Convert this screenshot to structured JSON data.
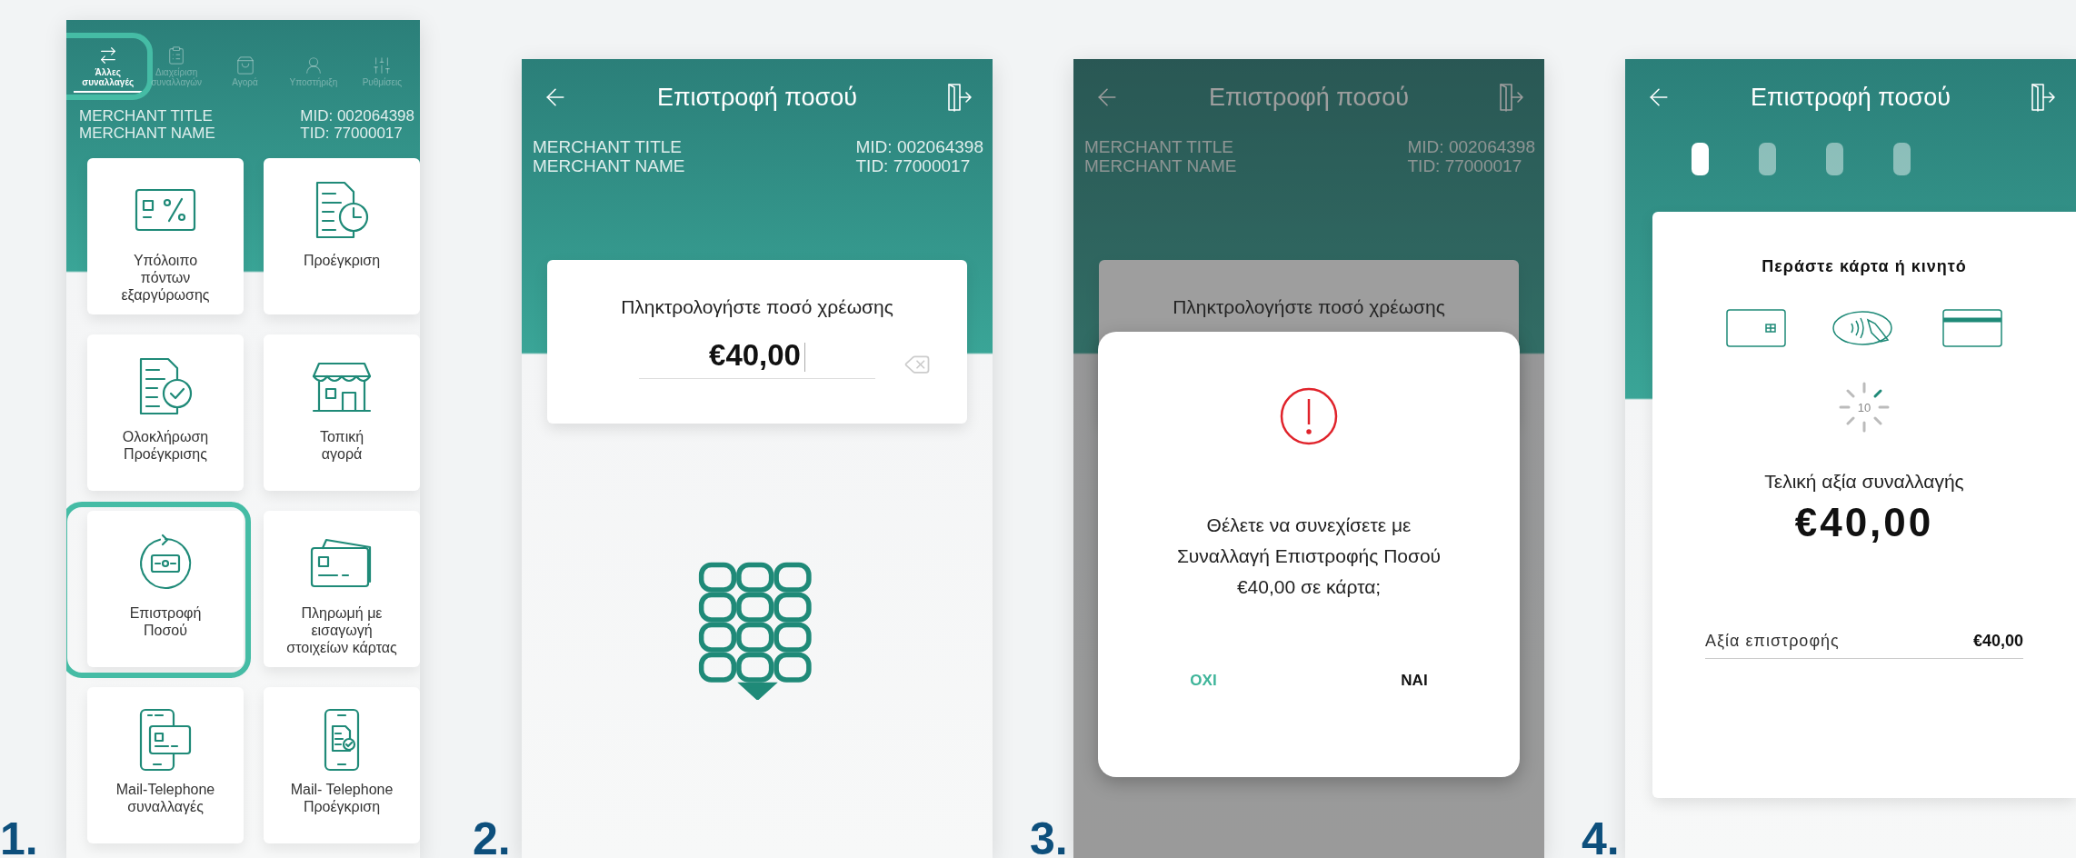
{
  "steps": [
    {
      "number": "1.",
      "kind": "menu",
      "screen": {
        "tabs": [
          {
            "label": "Άλλες\nσυναλλαγές",
            "selected": true,
            "highlighted": true
          },
          {
            "label": "Διαχείριση\nσυναλλαγών",
            "selected": false,
            "highlighted": false
          },
          {
            "label": "Αγορά",
            "selected": false,
            "highlighted": false
          },
          {
            "label": "Υποστήριξη",
            "selected": false,
            "highlighted": false
          },
          {
            "label": "Ρυθμίσεις",
            "selected": false,
            "highlighted": false
          }
        ],
        "merchant": {
          "title": "MERCHANT TITLE",
          "name": "MERCHANT NAME",
          "mid": "MID: 002064398",
          "tid": "TID: 77000017"
        },
        "tiles": [
          {
            "label": "Υπόλοιπο\nπόντων\nεξαργύρωσης",
            "highlighted": false
          },
          {
            "label": "Προέγκριση",
            "highlighted": false
          },
          {
            "label": "Ολοκλήρωση\nΠροέγκρισης",
            "highlighted": false
          },
          {
            "label": "Τοπική\nαγορά",
            "highlighted": false
          },
          {
            "label": "Επιστροφή\nΠοσού",
            "highlighted": true
          },
          {
            "label": "Πληρωμή με\nεισαγωγή\nστοιχείων κάρτας",
            "highlighted": false
          },
          {
            "label": "Mail-Telephone\nσυναλλαγές",
            "highlighted": false
          },
          {
            "label": "Mail- Telephone\nΠροέγκριση",
            "highlighted": false
          }
        ]
      }
    },
    {
      "number": "2.",
      "kind": "amount-entry",
      "screen": {
        "title": "Επιστροφή ποσού",
        "merchant": {
          "title": "MERCHANT TITLE",
          "name": "MERCHANT NAME",
          "mid": "MID: 002064398",
          "tid": "TID: 77000017"
        },
        "amount_label": "Πληκτρολογήστε ποσό χρέωσης",
        "amount_value": "€40,00"
      }
    },
    {
      "number": "3.",
      "kind": "confirm-dialog",
      "screen": {
        "title": "Επιστροφή ποσού",
        "merchant": {
          "title": "MERCHANT TITLE",
          "name": "MERCHANT NAME",
          "mid": "MID: 002064398",
          "tid": "TID: 77000017"
        },
        "amount_label": "Πληκτρολογήστε ποσό χρέωσης",
        "dialog": {
          "message": "Θέλετε να συνεχίσετε με\nΣυναλλαγή Επιστροφής Ποσού\n€40,00 σε κάρτα;",
          "buttons": [
            {
              "label": "ΟΧΙ",
              "kind": "cancel"
            },
            {
              "label": "ΝΑΙ",
              "kind": "confirm"
            }
          ]
        }
      }
    },
    {
      "number": "4.",
      "kind": "card-read",
      "screen": {
        "title": "Επιστροφή ποσού",
        "progress": [
          {
            "active": true
          },
          {
            "active": false
          },
          {
            "active": false
          },
          {
            "active": false
          }
        ],
        "prompt": "Περάστε κάρτα ή κινητό",
        "countdown": "10",
        "total_label": "Τελική αξία συναλλαγής",
        "total_value": "€40,00",
        "refund_label": "Αξία επιστροφής",
        "refund_value": "€40,00"
      }
    }
  ]
}
